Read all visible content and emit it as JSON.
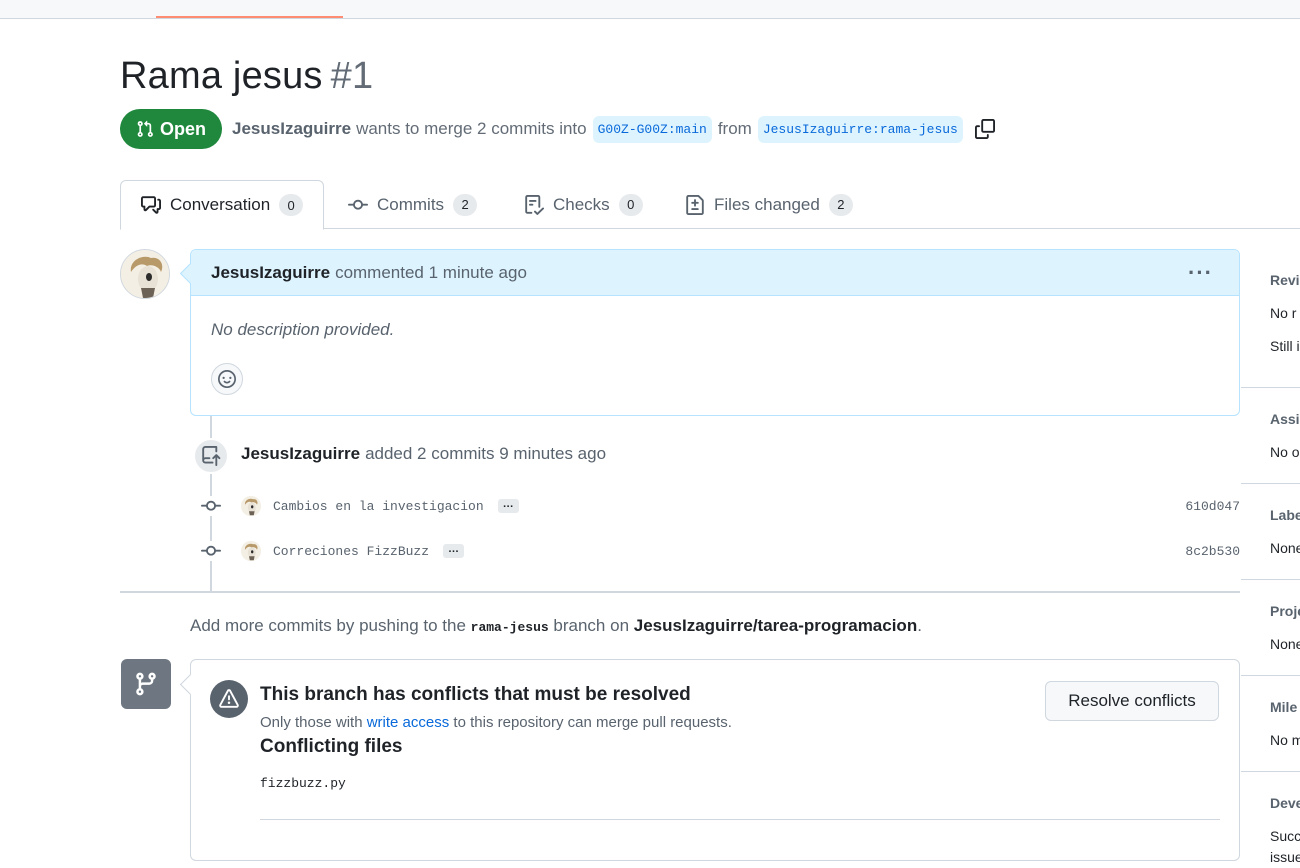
{
  "pr": {
    "title": "Rama jesus",
    "number": "#1",
    "state": "Open",
    "author": "JesusIzaguirre",
    "merge_text": "wants to merge 2 commits into",
    "base_branch": "G00Z-G00Z:main",
    "from_word": "from",
    "head_branch": "JesusIzaguirre:rama-jesus"
  },
  "tabs": [
    {
      "label": "Conversation",
      "count": "0"
    },
    {
      "label": "Commits",
      "count": "2"
    },
    {
      "label": "Checks",
      "count": "0"
    },
    {
      "label": "Files changed",
      "count": "2"
    }
  ],
  "comment": {
    "author": "JesusIzaguirre",
    "action": "commented 1 minute ago",
    "body": "No description provided."
  },
  "push_event": {
    "author": "JesusIzaguirre",
    "text": "added 2 commits 9 minutes ago"
  },
  "commits": [
    {
      "message": "Cambios en la investigacion",
      "more": "…",
      "sha": "610d047"
    },
    {
      "message": "Correciones FizzBuzz",
      "more": "…",
      "sha": "8c2b530"
    }
  ],
  "hint": {
    "prefix": "Add more commits by pushing to the",
    "branch": "rama-jesus",
    "middle": "branch on",
    "repo": "JesusIzaguirre/tarea-programacion",
    "suffix": "."
  },
  "merge": {
    "title": "This branch has conflicts that must be resolved",
    "sub_prefix": "Only those with",
    "sub_link": "write access",
    "sub_suffix": "to this repository can merge pull requests.",
    "files_title": "Conflicting files",
    "files": [
      "fizzbuzz.py"
    ],
    "resolve_label": "Resolve conflicts"
  },
  "sidebar": {
    "reviewers": {
      "label": "Revie",
      "value1": "No r",
      "value2": "Still i"
    },
    "assignees": {
      "label": "Assig",
      "value": "No o"
    },
    "labels": {
      "label": "Labe",
      "value": "None"
    },
    "projects": {
      "label": "Proje",
      "value": "None"
    },
    "milestone": {
      "label": "Mile",
      "value": "No m"
    },
    "development": {
      "label": "Deve",
      "value1": "Succ",
      "value2": "issue"
    }
  },
  "colors": {
    "open_green": "#1f883d",
    "link_blue": "#0969da",
    "comment_header": "#ddf4ff",
    "tab_underline": "#fd8c73"
  },
  "icons": [
    "pull-request-icon",
    "copy-icon",
    "comment-discussion-icon",
    "git-commit-icon",
    "checklist-icon",
    "file-diff-icon",
    "kebab-icon",
    "smiley-icon",
    "repo-push-icon",
    "git-branch-icon",
    "alert-icon"
  ]
}
